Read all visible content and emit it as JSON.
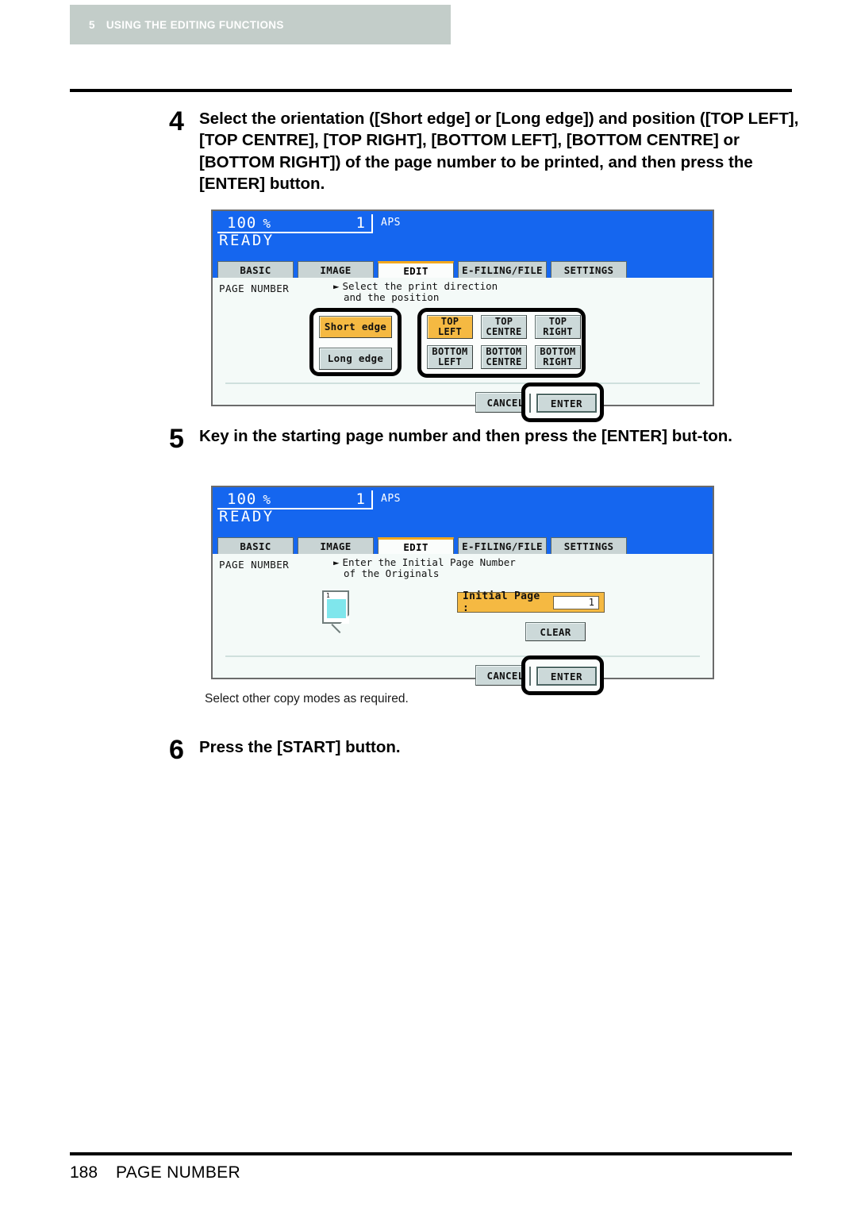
{
  "header": {
    "chapter_number": "5",
    "chapter_title": "USING THE EDITING FUNCTIONS"
  },
  "footer": {
    "page_number": "188",
    "section": "PAGE NUMBER"
  },
  "steps": {
    "step4": {
      "number": "4",
      "text": "Select the orientation ([Short edge] or [Long edge]) and position ([TOP LEFT], [TOP CENTRE], [TOP RIGHT], [BOTTOM LEFT], [BOTTOM CENTRE] or [BOTTOM RIGHT]) of the page number to be printed, and then press the [ENTER] button."
    },
    "step5": {
      "number": "5",
      "text": "Key in the starting page number and then press the [ENTER] but-ton."
    },
    "step6": {
      "number": "6",
      "text": "Press the [START] button."
    }
  },
  "note": "Select other copy modes as required.",
  "panel1": {
    "status": {
      "zoom_value": "100",
      "zoom_unit": "%",
      "copy_count": "1",
      "paper_mode": "APS",
      "ready": "READY"
    },
    "tabs": [
      {
        "label": "BASIC",
        "active": false
      },
      {
        "label": "IMAGE",
        "active": false
      },
      {
        "label": "EDIT",
        "active": true
      },
      {
        "label": "E-FILING/FILE",
        "active": false
      },
      {
        "label": "SETTINGS",
        "active": false
      }
    ],
    "function_name": "PAGE NUMBER",
    "instruction_line1": "Select the print direction",
    "instruction_line2": "and the position",
    "orientation_buttons": [
      {
        "label": "Short edge",
        "selected": true
      },
      {
        "label": "Long edge",
        "selected": false
      }
    ],
    "position_buttons": [
      {
        "line1": "TOP",
        "line2": "LEFT",
        "selected": true
      },
      {
        "line1": "TOP",
        "line2": "CENTRE",
        "selected": false
      },
      {
        "line1": "TOP",
        "line2": "RIGHT",
        "selected": false
      },
      {
        "line1": "BOTTOM",
        "line2": "LEFT",
        "selected": false
      },
      {
        "line1": "BOTTOM",
        "line2": "CENTRE",
        "selected": false
      },
      {
        "line1": "BOTTOM",
        "line2": "RIGHT",
        "selected": false
      }
    ],
    "cancel_label": "CANCEL",
    "enter_label": "ENTER"
  },
  "panel2": {
    "status": {
      "zoom_value": "100",
      "zoom_unit": "%",
      "copy_count": "1",
      "paper_mode": "APS",
      "ready": "READY"
    },
    "tabs": [
      {
        "label": "BASIC",
        "active": false
      },
      {
        "label": "IMAGE",
        "active": false
      },
      {
        "label": "EDIT",
        "active": true
      },
      {
        "label": "E-FILING/FILE",
        "active": false
      },
      {
        "label": "SETTINGS",
        "active": false
      }
    ],
    "function_name": "PAGE NUMBER",
    "instruction_line1": "Enter the Initial Page Number",
    "instruction_line2": "of the Originals",
    "page_icon_number": "1",
    "initial_page_label": "Initial Page :",
    "initial_page_value": "1",
    "clear_label": "CLEAR",
    "cancel_label": "CANCEL",
    "enter_label": "ENTER"
  },
  "colors": {
    "lcd_blue": "#1566ef",
    "selected_orange": "#f5b942",
    "tab_active_accent": "#f2a81e",
    "header_band": "#c3cdc9"
  }
}
